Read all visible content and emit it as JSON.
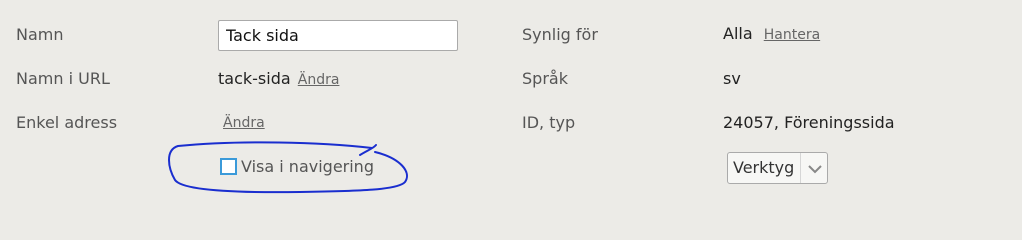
{
  "labels": {
    "name": "Namn",
    "url_name": "Namn i URL",
    "simple_address": "Enkel adress",
    "visible_for": "Synlig för",
    "language": "Språk",
    "id_type": "ID, typ"
  },
  "values": {
    "name_input": "Tack sida",
    "url_name": "tack-sida",
    "visible_for": "Alla",
    "language": "sv",
    "id_type": "24057, Föreningssida"
  },
  "links": {
    "change_url": "Ändra",
    "change_address": "Ändra",
    "manage": "Hantera"
  },
  "checkbox": {
    "label": "Visa i navigering",
    "checked": false
  },
  "tools_select": {
    "selected": "Verktyg"
  },
  "icons": {
    "dropdown": "chevron-down-icon"
  },
  "colors": {
    "background": "#ecebe7",
    "checkbox_border": "#3b9ad9",
    "annotation": "#1a2ecf"
  }
}
